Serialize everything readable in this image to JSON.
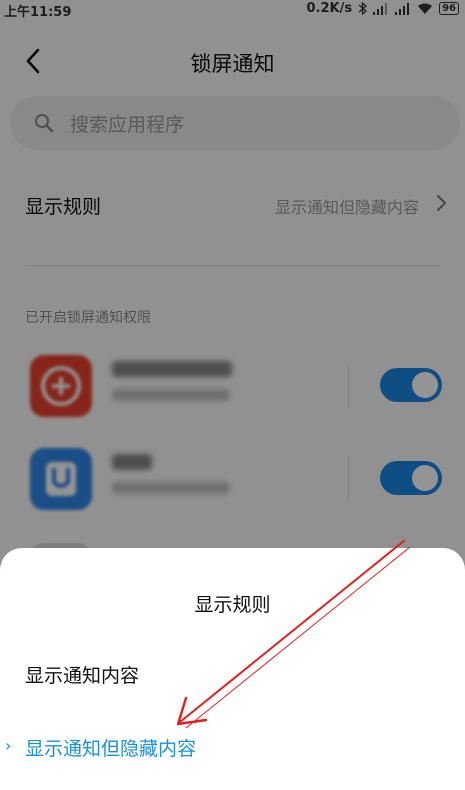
{
  "status_bar": {
    "time": "上午11:59",
    "network_speed": "0.2K/s",
    "battery": "96"
  },
  "header": {
    "title": "锁屏通知"
  },
  "search": {
    "placeholder": "搜索应用程序"
  },
  "display_rule": {
    "label": "显示规则",
    "value": "显示通知但隐藏内容"
  },
  "section_title": "已开启锁屏通知权限",
  "apps": [
    {
      "icon": "pinduoduo-app-icon",
      "icon_color": "#e8412e",
      "toggle": true
    },
    {
      "icon": "u-app-icon",
      "icon_color": "#2f86e8",
      "toggle": true
    }
  ],
  "sheet": {
    "title": "显示规则",
    "options": [
      "显示通知内容",
      "显示通知但隐藏内容"
    ],
    "selected_index": 1
  },
  "colors": {
    "accent": "#1a90d9",
    "toggle_on": "#1b86e6",
    "annotation": "#e02020"
  }
}
